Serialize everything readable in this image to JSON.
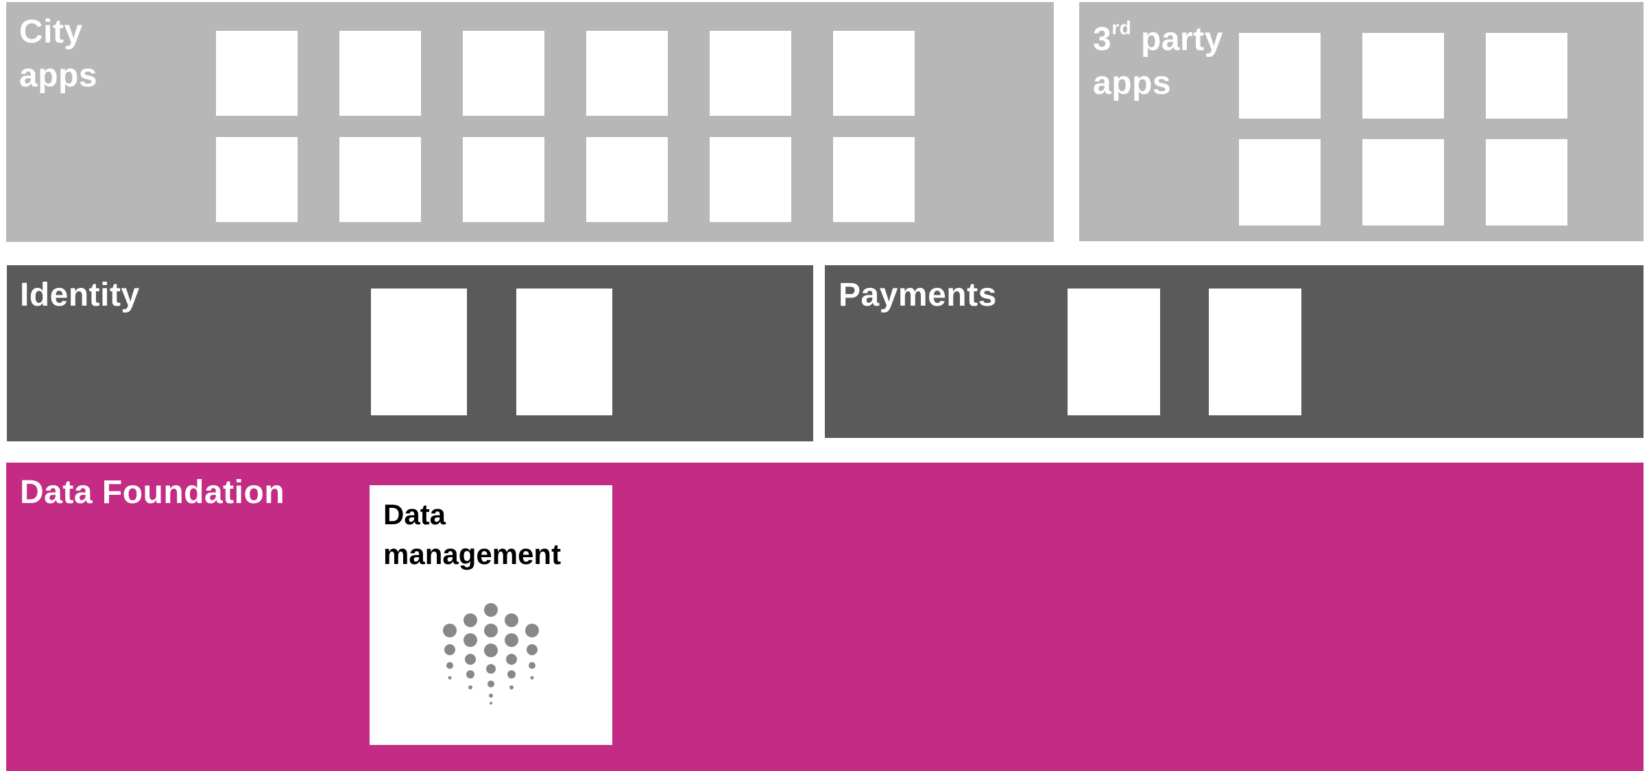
{
  "sections": {
    "city_apps": {
      "title_line1": "City",
      "title_line2": "apps"
    },
    "third_party_apps": {
      "title_num": "3",
      "title_sup": "rd",
      "title_rest": " party",
      "title_line2": "apps"
    },
    "identity": {
      "title": "Identity"
    },
    "payments": {
      "title": "Payments"
    },
    "data_foundation": {
      "title": "Data Foundation"
    }
  },
  "data_management": {
    "title_line1": "Data",
    "title_line2": "management",
    "icon": "dots-burst-icon"
  },
  "colors": {
    "apps_panel": "#b7b7b7",
    "platform_panel": "#5a5a5a",
    "data_panel": "#c42b84",
    "tile": "#ffffff",
    "icon": "#888888"
  }
}
